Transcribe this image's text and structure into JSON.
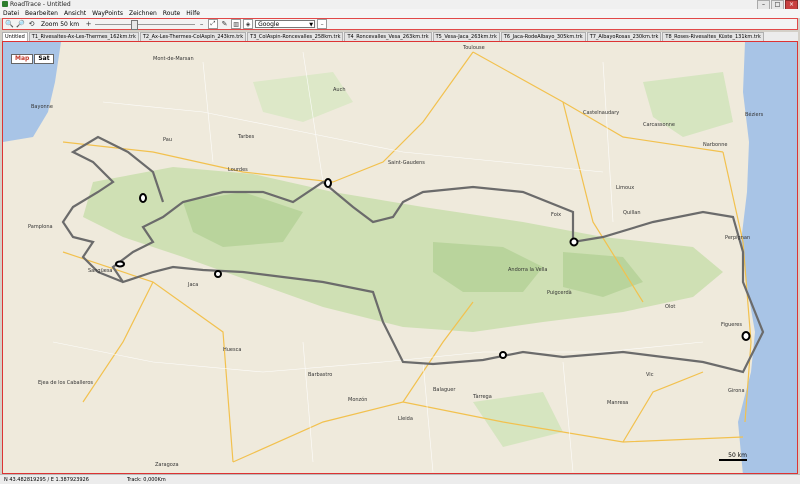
{
  "window": {
    "title": "RoadTrace - Untitled"
  },
  "menu": [
    "Datei",
    "Bearbeiten",
    "Ansicht",
    "WayPoints",
    "Zeichnen",
    "Route",
    "Hilfe"
  ],
  "toolbar": {
    "zoom_label": "Zoom 50 km",
    "map_source": "Google"
  },
  "tabs": [
    "Untitled",
    "T1_Rivesaltes-Ax-Les-Thermes_162km.trk",
    "T2_Ax-Les-Thermes-ColAspin_243km.trk",
    "T3_ColAspin-Roncevalles_258km.trk",
    "T4_Roncevalles_Vesa_263km.trk",
    "T5_Vesa-Jaca_263km.trk",
    "T6_Jaca-RodeAlbayo_305km.trk",
    "T7_AlbayoRosas_230km.trk",
    "T8_Roses-Rivesaltes_Küste_131km.trk"
  ],
  "map": {
    "type_buttons": [
      "Map",
      "Sat"
    ],
    "scale": "50 km",
    "places": [
      {
        "name": "Toulouse"
      },
      {
        "name": "Tarbes"
      },
      {
        "name": "Pau"
      },
      {
        "name": "Lourdes"
      },
      {
        "name": "Carcassonne"
      },
      {
        "name": "Narbonne"
      },
      {
        "name": "Béziers"
      },
      {
        "name": "Perpignan"
      },
      {
        "name": "Foix"
      },
      {
        "name": "Andorra la Vella"
      },
      {
        "name": "Pamplona"
      },
      {
        "name": "Sangüesa"
      },
      {
        "name": "Jaca"
      },
      {
        "name": "Huesca"
      },
      {
        "name": "Lleida"
      },
      {
        "name": "Girona"
      },
      {
        "name": "Figueres"
      },
      {
        "name": "Vic"
      },
      {
        "name": "Manresa"
      },
      {
        "name": "Zaragoza"
      },
      {
        "name": "Puigcerdà"
      },
      {
        "name": "Olot"
      },
      {
        "name": "Barbastro"
      },
      {
        "name": "Tàrrega"
      },
      {
        "name": "Balaguer"
      },
      {
        "name": "Monzón"
      },
      {
        "name": "Ejea de los Caballeros"
      },
      {
        "name": "Bayonne"
      },
      {
        "name": "Castelnaudary"
      },
      {
        "name": "Limoux"
      },
      {
        "name": "Quillan"
      },
      {
        "name": "Saint-Gaudens"
      },
      {
        "name": "Auch"
      },
      {
        "name": "Mont-de-Marsan"
      }
    ]
  },
  "status": {
    "coords": "N 43.482819295 / E 1.387923926",
    "track": "Track: 0,000Km"
  }
}
